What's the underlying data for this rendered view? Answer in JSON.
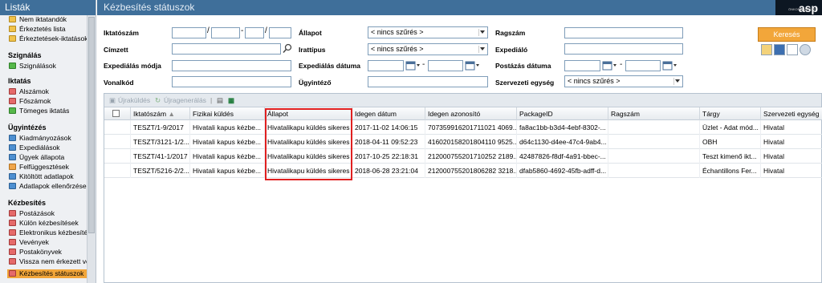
{
  "sidebar": {
    "title": "Listák",
    "items_top": [
      "Nem iktatandók",
      "Érkeztetés lista",
      "Érkeztetések-iktatások"
    ],
    "sec_szignalas": "Szignálás",
    "szignalas_items": [
      "Szignálások"
    ],
    "sec_iktatas": "Iktatás",
    "iktatas_items": [
      "Alszámok",
      "Főszámok",
      "Tömeges iktatás"
    ],
    "sec_ugyintezes": "Ügyintézés",
    "ugyintezes_items": [
      "Kiadmányozások",
      "Expediálások",
      "Ügyek állapota",
      "Felfüggesztések",
      "Kitöltött adatlapok",
      "Adatlapok ellenőrzése"
    ],
    "sec_kezbesites": "Kézbesítés",
    "kezbesites_items": [
      "Postázások",
      "Külön kézbesítések",
      "Elektronikus kézbesítés",
      "Vevények",
      "Postakönyvek",
      "Vissza nem érkezett ve",
      "Kézbesítés státuszok"
    ]
  },
  "header": {
    "title": "Kézbesítés státuszok",
    "logo": "asp",
    "logo_small": "ÖNKORMÁNYZATI"
  },
  "filters": {
    "iktatoszam": "Iktatószám",
    "cimzett": "Címzett",
    "expedialas_modja": "Expediálás módja",
    "vonalkod": "Vonalkód",
    "allapot": "Állapot",
    "allapot_value": "< nincs szűrés >",
    "irattipus": "Irattípus",
    "irattipus_value": "< nincs szűrés >",
    "expedialas_datuma": "Expediálás dátuma",
    "ugyintezo": "Ügyintéző",
    "ragszam": "Ragszám",
    "expedialo": "Expediáló",
    "postazas_datuma": "Postázás dátuma",
    "szervezeti_egyseg": "Szervezeti egység",
    "szervezeti_value": "< nincs szűrés >",
    "slash": "/",
    "dash": "-",
    "search_button": "Keresés"
  },
  "toolbar": {
    "ujrakuldes": "Újraküldés",
    "ujrageneralas": "Újragenerálás"
  },
  "columns": [
    "Iktatószám",
    "Fizikai küldés",
    "Állapot",
    "Idegen dátum",
    "Idegen azonosító",
    "PackageID",
    "Ragszám",
    "Tárgy",
    "Szervezeti egység"
  ],
  "rows": [
    [
      "TESZT/1-9/2017",
      "Hivatali kapus kézbe...",
      "Hivatalikapu küldés sikeres",
      "2017-11-02 14:06:15",
      "707359916201711021 4069...",
      "fa8ac1bb-b3d4-4ebf-8302-...",
      "",
      "Üzlet - Adat mód...",
      "Hivatal"
    ],
    [
      "TESZT/3121-1/2...",
      "Hivatali kapus kézbe...",
      "Hivatalikapu küldés sikeres",
      "2018-04-11 09:52:23",
      "416020158201804110 9525...",
      "d64c1130-d4ee-47c4-9ab4...",
      "",
      "OBH",
      "Hivatal"
    ],
    [
      "TESZT/41-1/2017",
      "Hivatali kapus kézbe...",
      "Hivatalikapu küldés sikeres",
      "2017-10-25 22:18:31",
      "212000755201710252 2189...",
      "42487826-f8df-4a91-bbec-...",
      "",
      "Teszt kimenő ikt...",
      "Hivatal"
    ],
    [
      "TESZT/5216-2/2...",
      "Hivatali kapus kézbe...",
      "Hivatalikapu küldés sikeres",
      "2018-06-28 23:21:04",
      "212000755201806282 3218...",
      "dfab5860-4692-45fb-adff-d...",
      "",
      "Échantillons Fer...",
      "Hivatal"
    ]
  ]
}
